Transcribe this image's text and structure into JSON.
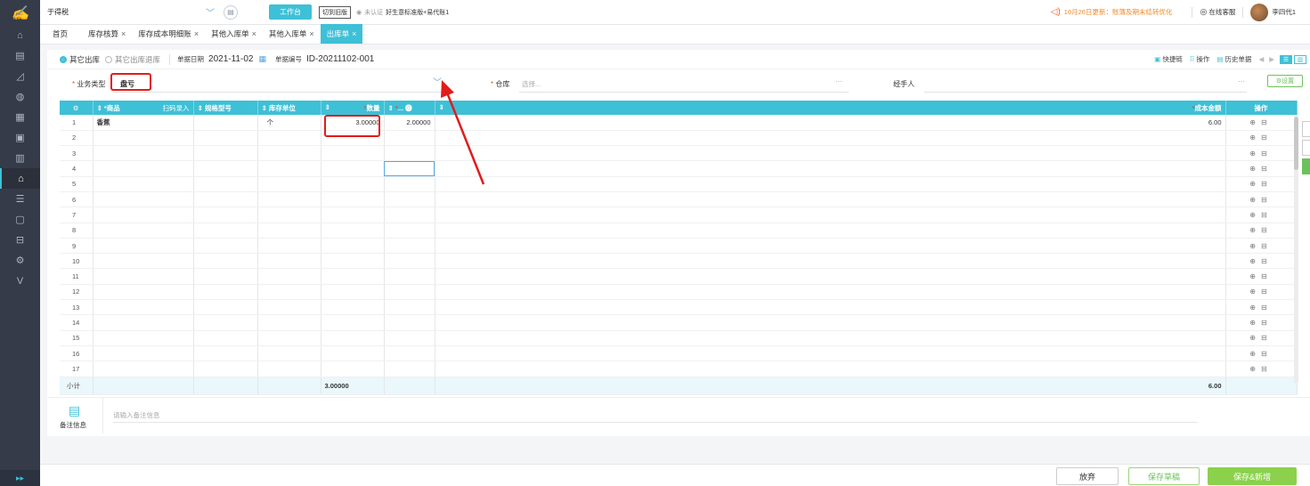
{
  "topbar": {
    "company": "于得税",
    "workbench": "工作台",
    "switch_old": "切到旧版",
    "cert_status": "未认证",
    "account": "好生意标准版+易代账1",
    "notice": "10月26日更新：账簿及期末结转优化",
    "service": "在线客服",
    "username": "李四代1"
  },
  "tabs": [
    {
      "label": "首页",
      "closable": false
    },
    {
      "label": "库存核算",
      "closable": true
    },
    {
      "label": "库存成本明细账",
      "closable": true
    },
    {
      "label": "其他入库单",
      "closable": true
    },
    {
      "label": "其他入库单",
      "closable": true
    },
    {
      "label": "出库单",
      "closable": true,
      "active": true
    }
  ],
  "tab_close": "×",
  "form": {
    "radio_other_out": "其它出库",
    "radio_other_return": "其它出库退库",
    "date_label": "单据日期",
    "date_value": "2021-11-02",
    "bill_no_label": "单据编号",
    "bill_no_value": "ID-20211102-001",
    "quick_chain": "快捷链",
    "operate": "操作",
    "history": "历史单据",
    "biz_type_label": "业务类型",
    "biz_type_value": "盘亏",
    "warehouse_label": "仓库",
    "warehouse_placeholder": "选择...",
    "handler_label": "经手人",
    "settings": "设置",
    "ellipsis": "···",
    "required_mark": "*"
  },
  "table": {
    "headers": {
      "product": "商品",
      "scan": "扫码录入",
      "spec": "规格型号",
      "unit": "库存单位",
      "qty": "数量",
      "price": "...",
      "amount": "成本金额",
      "ops": "操作"
    },
    "rows": [
      {
        "idx": "1",
        "product": "香蕉",
        "unit": "个",
        "qty": "3.00000",
        "price": "2.00000",
        "amount": "6.00"
      },
      {
        "idx": "2"
      },
      {
        "idx": "3"
      },
      {
        "idx": "4"
      },
      {
        "idx": "5"
      },
      {
        "idx": "6"
      },
      {
        "idx": "7"
      },
      {
        "idx": "8"
      },
      {
        "idx": "9"
      },
      {
        "idx": "10"
      },
      {
        "idx": "11"
      },
      {
        "idx": "12"
      },
      {
        "idx": "13"
      },
      {
        "idx": "14"
      },
      {
        "idx": "15"
      },
      {
        "idx": "16"
      },
      {
        "idx": "17"
      }
    ],
    "subtotal_label": "小计",
    "subtotal_qty": "3.00000",
    "subtotal_amount": "6.00"
  },
  "remark": {
    "title": "备注信息",
    "placeholder": "请输入备注信息"
  },
  "footer": {
    "giveup": "放弃",
    "save_draft": "保存草稿",
    "save_new": "保存&新增"
  },
  "colors": {
    "accent": "#3ec0d6",
    "highlight": "#e21b1b",
    "green": "#8bd14c"
  }
}
